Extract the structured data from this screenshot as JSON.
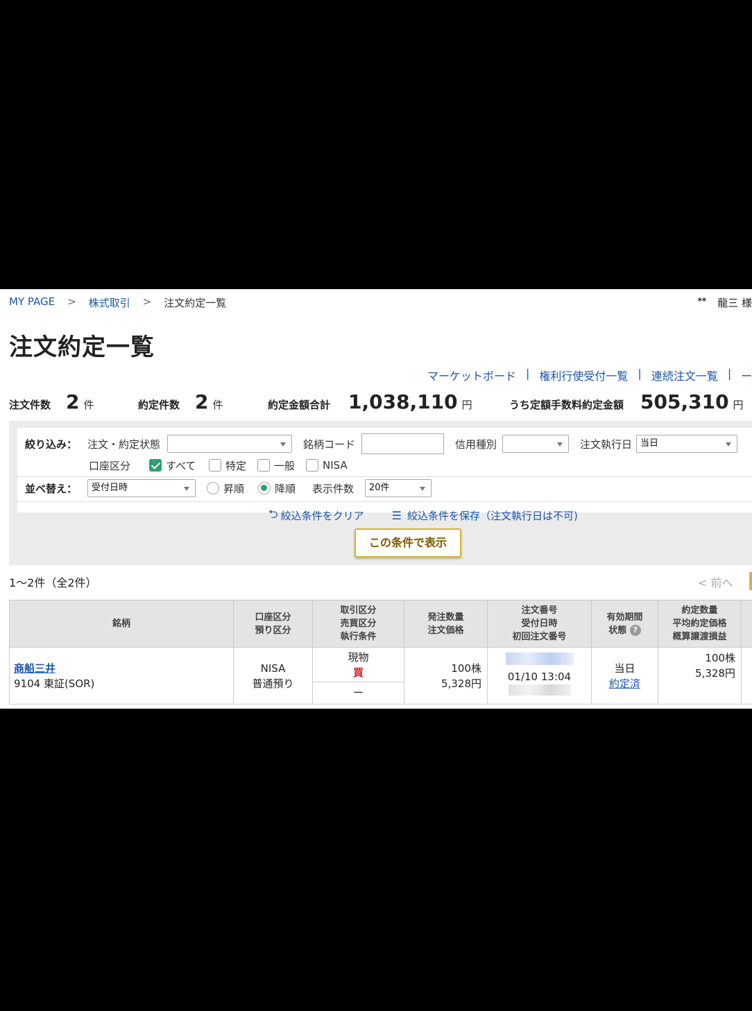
{
  "breadcrumb": {
    "home": "MY PAGE",
    "sep": ">",
    "section": "株式取引",
    "current": "注文約定一覧"
  },
  "user": {
    "stars": "**",
    "name": "龍三 様"
  },
  "page_title": "注文約定一覧",
  "top_links": [
    "マーケットボード",
    "権利行使受付一覧",
    "連続注文一覧",
    "ー"
  ],
  "top_links_sep": "|",
  "summary": {
    "orders_label": "注文件数",
    "orders_value": "2",
    "orders_unit": "件",
    "fills_label": "約定件数",
    "fills_value": "2",
    "fills_unit": "件",
    "total_label": "約定金額合計",
    "total_value": "1,038,110",
    "total_unit": "円",
    "fixed_label": "うち定額手数料約定金額",
    "fixed_value": "505,310",
    "fixed_unit": "円"
  },
  "filter": {
    "label": "絞り込み：",
    "status_label": "注文・約定状態",
    "status_value": "",
    "code_label": "銘柄コード",
    "code_value": "",
    "credit_label": "信用種別",
    "credit_value": "",
    "date_label": "注文執行日",
    "date_value": "当日",
    "account_label": "口座区分",
    "account_options": [
      {
        "label": "すべて",
        "checked": true
      },
      {
        "label": "特定",
        "checked": false
      },
      {
        "label": "一般",
        "checked": false
      },
      {
        "label": "NISA",
        "checked": false
      }
    ]
  },
  "sort": {
    "label": "並べ替え：",
    "field_value": "受付日時",
    "asc_label": "昇順",
    "desc_label": "降順",
    "selected": "降順",
    "per_page_label": "表示件数",
    "per_page_value": "20件"
  },
  "actions": {
    "clear": "絞込条件をクリア",
    "save": "絞込条件を保存（注文執行日は不可)"
  },
  "show_button": "この条件で表示",
  "results_count": "1〜2件（全2件）",
  "prev_label": "< 前へ",
  "table": {
    "headers": [
      [
        "銘柄"
      ],
      [
        "口座区分",
        "預り区分"
      ],
      [
        "取引区分",
        "売買区分",
        "執行条件"
      ],
      [
        "発注数量",
        "注文価格"
      ],
      [
        "注文番号",
        "受付日時",
        "初回注文番号"
      ],
      [
        "有効期間",
        "状態"
      ],
      [
        "約定数量",
        "平均約定価格",
        "概算譲渡損益"
      ]
    ],
    "rows": [
      {
        "stock_name": "商船三井",
        "stock_code": "9104 東証(SOR)",
        "account": "NISA",
        "deposit": "普通預り",
        "trade_type": "現物",
        "side": "買",
        "condition": "ー",
        "qty": "100株",
        "price": "5,328円",
        "received_at": "01/10 13:04",
        "validity": "当日",
        "status": "約定済",
        "filled_qty": "100株",
        "avg_price": "5,328円"
      }
    ]
  },
  "colors": {
    "link": "#1a56a8",
    "accent_green": "#2e9f70",
    "buy_red": "#d0262b",
    "button_border": "#d4b437"
  }
}
